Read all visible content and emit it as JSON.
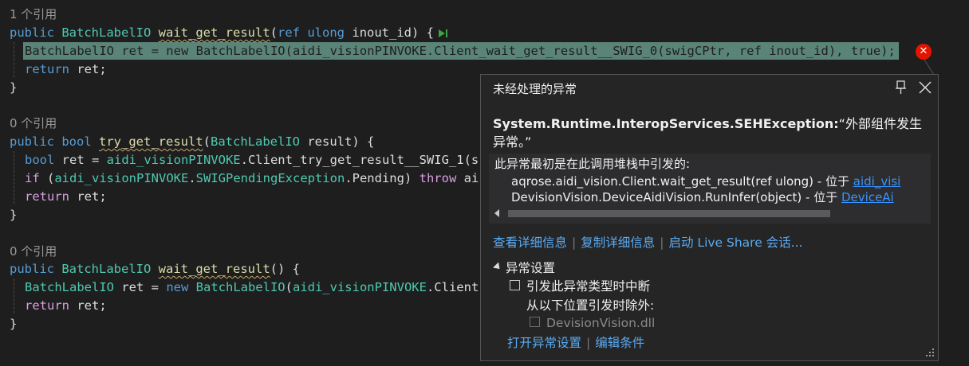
{
  "code": {
    "block1": {
      "refs": "1 个引用",
      "sig_kw": "public",
      "sig_type": "BatchLabelIO",
      "sig_method": "wait_get_result",
      "sig_paren_open": "(",
      "sig_ref": "ref",
      "sig_ulong": "ulong",
      "sig_param": "inout_id) {",
      "line1": "BatchLabelIO ret = new BatchLabelIO(aidi_visionPINVOKE.Client_wait_get_result__SWIG_0(swigCPtr, ref inout_id), true);",
      "line2_kw": "return",
      "line2_rest": " ret;",
      "close": "}"
    },
    "block2": {
      "refs": "0 个引用",
      "sig_kw": "public",
      "sig_bool": "bool",
      "sig_method": "try_get_result",
      "sig_paren": "(",
      "sig_type": "BatchLabelIO",
      "sig_rest": " result) {",
      "l1_bool": "bool",
      "l1_mid": " ret = ",
      "l1_cls": "aidi_visionPINVOKE",
      "l1_call": ".Client_try_get_result__SWIG_1(s",
      "l2_if": "if",
      "l2_paren": " (",
      "l2_cls": "aidi_visionPINVOKE",
      "l2_dot": ".",
      "l2_exc": "SWIGPendingException",
      "l2_pend": ".Pending) ",
      "l2_throw": "throw",
      "l2_tail": " ai",
      "l3_kw": "return",
      "l3_rest": " ret;",
      "close": "}"
    },
    "block3": {
      "refs": "0 个引用",
      "sig_kw": "public",
      "sig_type": "BatchLabelIO",
      "sig_method": "wait_get_result",
      "sig_rest": "() {",
      "l1_type": "BatchLabelIO",
      "l1_mid": " ret = ",
      "l1_new": "new",
      "l1_type2": "BatchLabelIO",
      "l1_paren": "(",
      "l1_cls": "aidi_visionPINVOKE",
      "l1_tail": ".Client",
      "l2_kw": "return",
      "l2_rest": " ret;",
      "close": "}"
    }
  },
  "error_icon": "✕",
  "popup": {
    "title": "未经处理的异常",
    "exception_type": "System.Runtime.InteropServices.SEHException:",
    "exception_message": "“外部组件发生异常。”",
    "stack_header": "此异常最初是在此调用堆栈中引发的:",
    "stack": [
      {
        "text": "aqrose.aidi_vision.Client.wait_get_result(ref ulong) - 位于 ",
        "link": "aidi_visi"
      },
      {
        "text": "DevisionVision.DeviceAidiVision.RunInfer(object) - 位于 ",
        "link": "DeviceAi"
      }
    ],
    "links": [
      "查看详细信息",
      "复制详细信息",
      "启动 Live Share 会话..."
    ],
    "settings_header": "异常设置",
    "break_option": "引发此异常类型时中断",
    "except_label": "从以下位置引发时除外:",
    "except_item": "DevisionVision.dll",
    "bottom_links": [
      "打开异常设置",
      "编辑条件"
    ]
  }
}
